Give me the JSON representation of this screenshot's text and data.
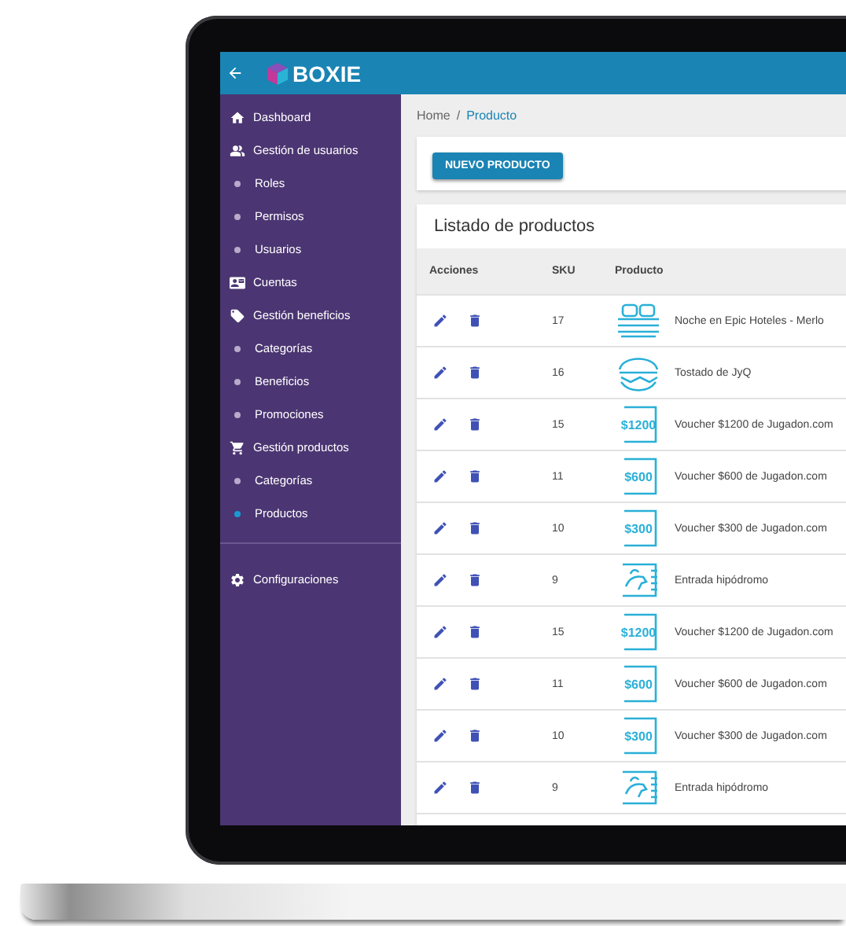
{
  "app_bar": {
    "logo": "BOXIE"
  },
  "sidebar": {
    "items": [
      {
        "label": "Dashboard"
      },
      {
        "label": "Gestión de usuarios",
        "children": [
          {
            "label": "Roles",
            "selected": false
          },
          {
            "label": "Permisos",
            "selected": false
          },
          {
            "label": "Usuarios",
            "selected": false
          }
        ]
      },
      {
        "label": "Cuentas"
      },
      {
        "label": "Gestión beneficios",
        "children": [
          {
            "label": "Categorías",
            "selected": false
          },
          {
            "label": "Beneficios",
            "selected": false
          },
          {
            "label": "Promociones",
            "selected": false
          }
        ]
      },
      {
        "label": "Gestión productos",
        "children": [
          {
            "label": "Categorías",
            "selected": false
          },
          {
            "label": "Productos",
            "selected": true
          }
        ]
      }
    ],
    "footer_items": [
      {
        "label": "Configuraciones"
      }
    ]
  },
  "breadcrumb": [
    {
      "label": "Home"
    },
    {
      "label": "Producto"
    }
  ],
  "breadcrumb_separator": "/",
  "new_button": "NUEVO PRODUCTO",
  "table": {
    "title": "Listado de productos",
    "columns": [
      "Acciones",
      "SKU",
      "Producto"
    ],
    "rows": [
      {
        "sku": "17",
        "image": {
          "kind": "bed"
        },
        "name": "Noche en Epic Hoteles - Merlo"
      },
      {
        "sku": "16",
        "image": {
          "kind": "food"
        },
        "name": "Tostado de JyQ"
      },
      {
        "sku": "15",
        "image": {
          "kind": "voucher",
          "amount": "$1200"
        },
        "name": "Voucher $1200 de Jugadon.com"
      },
      {
        "sku": "11",
        "image": {
          "kind": "voucher",
          "amount": "$600"
        },
        "name": "Voucher $600 de Jugadon.com"
      },
      {
        "sku": "10",
        "image": {
          "kind": "voucher",
          "amount": "$300"
        },
        "name": "Voucher $300 de Jugadon.com"
      },
      {
        "sku": "9",
        "image": {
          "kind": "horse"
        },
        "name": "Entrada hipódromo"
      },
      {
        "sku": "15",
        "image": {
          "kind": "voucher",
          "amount": "$1200"
        },
        "name": "Voucher $1200 de Jugadon.com"
      },
      {
        "sku": "11",
        "image": {
          "kind": "voucher",
          "amount": "$600"
        },
        "name": "Voucher $600 de Jugadon.com"
      },
      {
        "sku": "10",
        "image": {
          "kind": "voucher",
          "amount": "$300"
        },
        "name": "Voucher $300 de Jugadon.com"
      },
      {
        "sku": "9",
        "image": {
          "kind": "horse"
        },
        "name": "Entrada hipódromo"
      }
    ]
  }
}
